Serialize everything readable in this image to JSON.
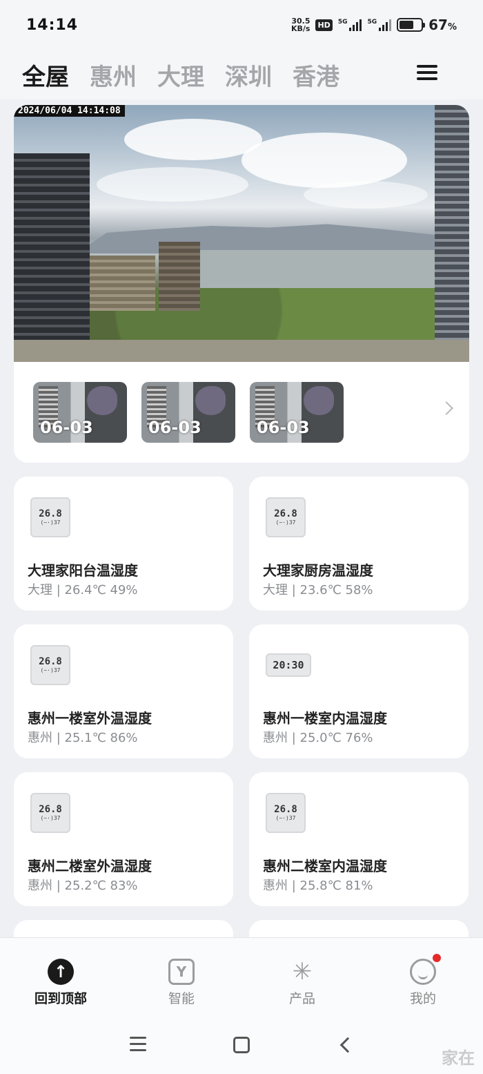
{
  "status_bar": {
    "time": "14:14",
    "net_speed_value": "30.5",
    "net_speed_unit": "KB/s",
    "hd_badge": "HD",
    "sim1": "5G",
    "sim2": "5G",
    "battery_percent": "67",
    "battery_unit": "%",
    "battery_level": 0.67
  },
  "tabs": [
    {
      "label": "全屋",
      "active": true
    },
    {
      "label": "惠州",
      "active": false
    },
    {
      "label": "大理",
      "active": false
    },
    {
      "label": "深圳",
      "active": false
    },
    {
      "label": "香港",
      "active": false
    }
  ],
  "menu_icon": "hamburger-icon",
  "camera": {
    "timestamp": "2024/06/04  14:14:08",
    "thumbnails": [
      {
        "date": "06-03"
      },
      {
        "date": "06-03"
      },
      {
        "date": "06-03"
      }
    ],
    "more_icon": "chevron-right-icon"
  },
  "devices": [
    {
      "name": "大理家阳台温湿度",
      "status": "大理 | 26.4℃ 49%",
      "icon_main": "26.8",
      "icon_sub": "(~·)37",
      "icon": "hygrometer-icon"
    },
    {
      "name": "大理家厨房温湿度",
      "status": "大理 | 23.6℃ 58%",
      "icon_main": "26.8",
      "icon_sub": "(~·)37",
      "icon": "hygrometer-icon"
    },
    {
      "name": "惠州一楼室外温湿度",
      "status": "惠州 | 25.1℃ 86%",
      "icon_main": "26.8",
      "icon_sub": "(~·)37",
      "icon": "hygrometer-icon"
    },
    {
      "name": "惠州一楼室内温湿度",
      "status": "惠州 | 25.0℃ 76%",
      "icon_main": "20:30",
      "icon_sub": "",
      "icon": "clock-hygrometer-icon"
    },
    {
      "name": "惠州二楼室外温湿度",
      "status": "惠州 | 25.2℃ 83%",
      "icon_main": "26.8",
      "icon_sub": "(~·)37",
      "icon": "hygrometer-icon"
    },
    {
      "name": "惠州二楼室内温湿度",
      "status": "惠州 | 25.8℃ 81%",
      "icon_main": "26.8",
      "icon_sub": "(~·)37",
      "icon": "hygrometer-icon"
    }
  ],
  "bottom_nav": [
    {
      "label": "回到顶部",
      "icon": "arrow-up-icon",
      "active": true
    },
    {
      "label": "智能",
      "icon": "cube-icon",
      "active": false
    },
    {
      "label": "产品",
      "icon": "sparkle-icon",
      "active": false
    },
    {
      "label": "我的",
      "icon": "smile-icon",
      "active": false,
      "badge": true
    }
  ],
  "system_nav": [
    "menu-icon",
    "home-icon",
    "back-icon"
  ],
  "watermark": "家在"
}
